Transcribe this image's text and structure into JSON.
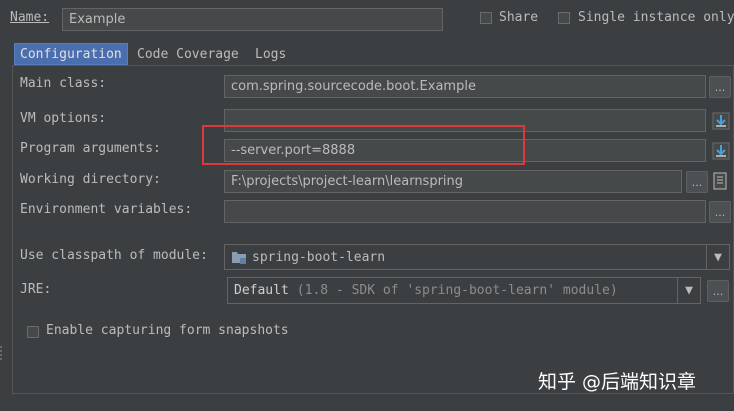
{
  "header": {
    "name_label": "Name:",
    "name_value": "Example",
    "share_label": "Share",
    "single_instance_label": "Single instance only"
  },
  "tabs": [
    {
      "label": "Configuration",
      "active": true
    },
    {
      "label": "Code Coverage",
      "active": false
    },
    {
      "label": "Logs",
      "active": false
    }
  ],
  "form": {
    "main_class": {
      "label": "Main class:",
      "value": "com.spring.sourcecode.boot.Example"
    },
    "vm_options": {
      "label": "VM options:",
      "value": ""
    },
    "program_arguments": {
      "label": "Program arguments:",
      "value": "--server.port=8888"
    },
    "working_directory": {
      "label": "Working directory:",
      "value": "F:\\projects\\project-learn\\learnspring"
    },
    "environment_variables": {
      "label": "Environment variables:",
      "value": ""
    },
    "classpath_module": {
      "label": "Use classpath of module:",
      "value": "spring-boot-learn"
    },
    "jre": {
      "label": "JRE:",
      "value": "Default",
      "detail": "(1.8 - SDK of 'spring-boot-learn' module)"
    },
    "form_snapshots": {
      "label": "Enable capturing form snapshots"
    }
  },
  "buttons": {
    "ellipsis": "..."
  },
  "watermark": "知乎 @后端知识章",
  "colors": {
    "background": "#3c3f41",
    "field": "#45494a",
    "tab_active": "#4b6eaf",
    "highlight_box": "#d93a3a"
  }
}
